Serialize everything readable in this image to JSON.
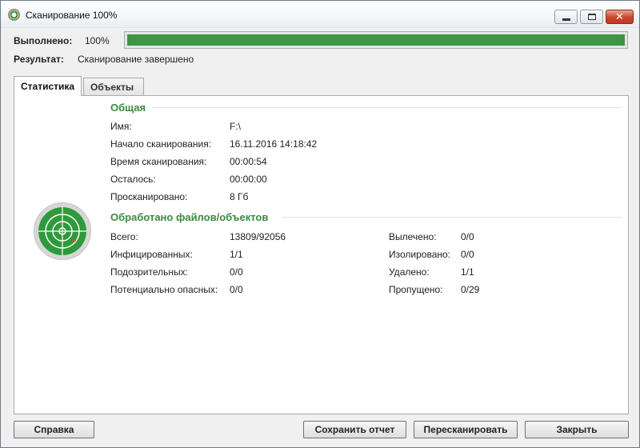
{
  "window": {
    "title": "Сканирование 100%"
  },
  "progress": {
    "label": "Выполнено:",
    "value_text": "100%",
    "percent": 100,
    "color": "#3f9546"
  },
  "result": {
    "label": "Результат:",
    "value": "Сканирование завершено"
  },
  "tabs": [
    {
      "label": "Статистика",
      "active": true
    },
    {
      "label": "Объекты",
      "active": false
    }
  ],
  "general": {
    "title": "Общая",
    "rows": [
      {
        "label": "Имя:",
        "value": "F:\\"
      },
      {
        "label": "Начало сканирования:",
        "value": "16.11.2016 14:18:42"
      },
      {
        "label": "Время сканирования:",
        "value": "00:00:54"
      },
      {
        "label": "Осталось:",
        "value": "00:00:00"
      },
      {
        "label": "Просканировано:",
        "value": "8 Гб"
      }
    ]
  },
  "processed": {
    "title": "Обработано файлов/объектов",
    "left": [
      {
        "label": "Всего:",
        "value": "13809/92056"
      },
      {
        "label": "Инфицированных:",
        "value": "1/1"
      },
      {
        "label": "Подозрительных:",
        "value": "0/0"
      },
      {
        "label": "Потенциально опасных:",
        "value": "0/0"
      }
    ],
    "right": [
      {
        "label": "Вылечено:",
        "value": "0/0"
      },
      {
        "label": "Изолировано:",
        "value": "0/0"
      },
      {
        "label": "Удалено:",
        "value": "1/1"
      },
      {
        "label": "Пропущено:",
        "value": "0/29"
      }
    ]
  },
  "buttons": {
    "help": "Справка",
    "save_report": "Сохранить отчет",
    "rescan": "Пересканировать",
    "close": "Закрыть"
  },
  "colors": {
    "accent_green": "#3a8a3f",
    "radar_green": "#2e9a3c"
  }
}
